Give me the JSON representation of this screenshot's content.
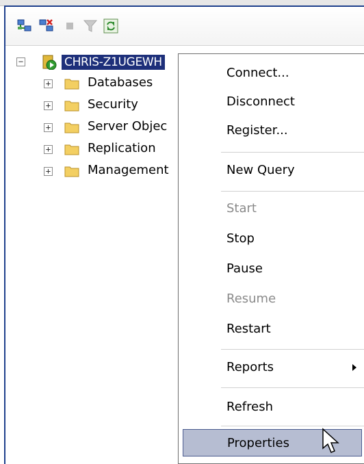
{
  "tree": {
    "server": {
      "label": "CHRIS-Z1UGEWH",
      "icon": "server-icon"
    },
    "nodes": [
      {
        "label": "Databases",
        "icon": "folder-icon",
        "expander": "+"
      },
      {
        "label": "Security",
        "icon": "folder-icon",
        "expander": "+"
      },
      {
        "label": "Server Objec",
        "icon": "folder-icon",
        "expander": "+"
      },
      {
        "label": "Replication",
        "icon": "folder-icon",
        "expander": "+"
      },
      {
        "label": "Management",
        "icon": "folder-icon",
        "expander": "+"
      }
    ],
    "server_expander": "−"
  },
  "menu": {
    "items": [
      {
        "label": "Connect...",
        "enabled": true
      },
      {
        "label": "Disconnect",
        "enabled": true
      },
      {
        "label": "Register...",
        "enabled": true
      },
      {
        "label": "New Query",
        "enabled": true
      },
      {
        "label": "Start",
        "enabled": false
      },
      {
        "label": "Stop",
        "enabled": true
      },
      {
        "label": "Pause",
        "enabled": true
      },
      {
        "label": "Resume",
        "enabled": false
      },
      {
        "label": "Restart",
        "enabled": true
      },
      {
        "label": "Reports",
        "enabled": true,
        "submenu": true
      },
      {
        "label": "Refresh",
        "enabled": true
      },
      {
        "label": "Properties",
        "enabled": true,
        "highlighted": true
      }
    ]
  },
  "colors": {
    "selection": "#1d2f7a",
    "menu_highlight": "#b6bdd2",
    "frame": "#1d3f8c"
  }
}
